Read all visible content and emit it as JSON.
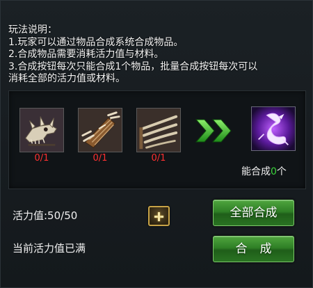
{
  "instructions": {
    "title": "玩法说明：",
    "line1": "1.玩家可以通过物品合成系统合成物品。",
    "line2": "2.合成物品需要消耗活力值与材料。",
    "line3": "3.合成按钮每次只能合成1个物品，批量合成按钮每次可以",
    "line4": "消耗全部的活力值或材料。"
  },
  "materials": [
    {
      "icon": "dragon-skull-icon",
      "count": "0/1"
    },
    {
      "icon": "bone-bracer-icon",
      "count": "0/1"
    },
    {
      "icon": "bone-claw-icon",
      "count": "0/1"
    }
  ],
  "result": {
    "icon": "purple-dragon-icon",
    "prefix": "能合成",
    "count": "0",
    "suffix": "个"
  },
  "stamina": {
    "text": "活力值:50/50"
  },
  "status": {
    "text": "当前活力值已满"
  },
  "buttons": {
    "synthesize_all": "全部合成",
    "synthesize": "合成"
  },
  "colors": {
    "count_red": "#ff3030",
    "result_green": "#3bd33b",
    "button_green": "#2f7f26",
    "plus_gold": "#c7a347"
  }
}
